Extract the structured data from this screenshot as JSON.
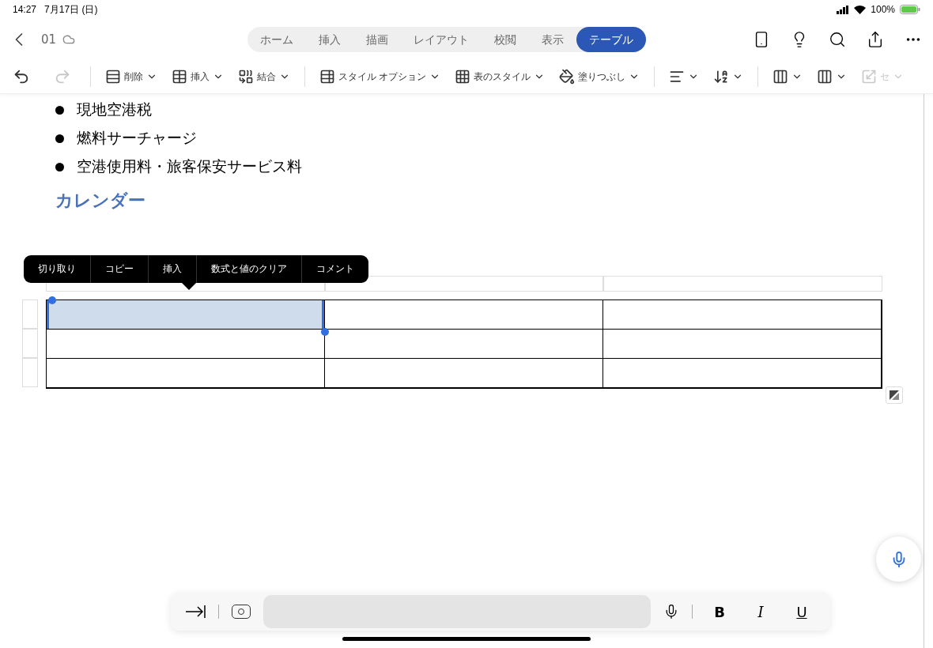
{
  "status_bar": {
    "time": "14:27",
    "date": "7月17日 (日)",
    "battery": "100%"
  },
  "header": {
    "doc_name": "01",
    "tabs": [
      {
        "label": "ホーム",
        "selected": false
      },
      {
        "label": "挿入",
        "selected": false
      },
      {
        "label": "描画",
        "selected": false
      },
      {
        "label": "レイアウト",
        "selected": false
      },
      {
        "label": "校閲",
        "selected": false
      },
      {
        "label": "表示",
        "selected": false
      },
      {
        "label": "テーブル",
        "selected": true
      }
    ]
  },
  "toolbar": [
    {
      "kind": "icon",
      "disabled": false
    },
    {
      "kind": "icon",
      "disabled": true
    },
    {
      "kind": "dropdown",
      "label": "削除",
      "disabled": false
    },
    {
      "kind": "dropdown",
      "label": "挿入",
      "disabled": false
    },
    {
      "kind": "dropdown",
      "label": "結合",
      "disabled": false
    },
    {
      "kind": "dropdown",
      "label": "スタイル オプション",
      "disabled": false
    },
    {
      "kind": "dropdown",
      "label": "表のスタイル",
      "disabled": false
    },
    {
      "kind": "dropdown",
      "label": "塗りつぶし",
      "disabled": false
    },
    {
      "kind": "dropdown",
      "disabled": false
    },
    {
      "kind": "dropdown",
      "disabled": false
    },
    {
      "kind": "dropdown",
      "disabled": false
    },
    {
      "kind": "dropdown",
      "disabled": false
    },
    {
      "kind": "dropdown",
      "label": "セ",
      "disabled": true
    }
  ],
  "document": {
    "bullets": [
      "現地空港税",
      "燃料サーチャージ",
      "空港使用料・旅客保安サービス料"
    ],
    "heading": "カレンダー",
    "table": {
      "rows": [
        [
          {
            "selected": true
          },
          {
            "selected": false
          },
          {
            "selected": false
          }
        ],
        [
          {
            "selected": false
          },
          {
            "selected": false
          },
          {
            "selected": false
          }
        ],
        [
          {
            "selected": false
          },
          {
            "selected": false
          },
          {
            "selected": false
          }
        ]
      ]
    }
  },
  "context_menu": [
    "切り取り",
    "コピー",
    "挿入",
    "数式と値のクリア",
    "コメント"
  ],
  "bottom_bar": {
    "bold": "B",
    "italic": "I",
    "underline": "U"
  }
}
